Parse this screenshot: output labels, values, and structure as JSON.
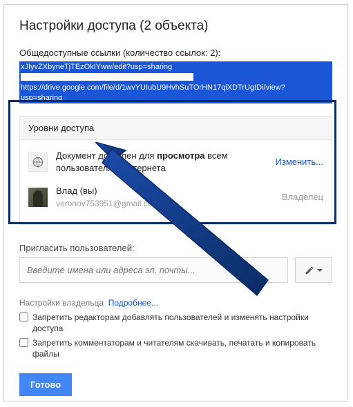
{
  "title": "Настройки доступа (2 объекта)",
  "links": {
    "label": "Общедоступные ссылки (количество ссылок: 2):",
    "line1": "xJIyvZXbyneTjTEzOkIYww/edit?usp=sharing",
    "line2": "https://drive.google.com/file/d/1wvYUIubU9HvhSuTOrHN17qlXDTrUgIDi/view?",
    "line3": "usp=sharing"
  },
  "access": {
    "header": "Уровни доступа",
    "rows": [
      {
        "text_prefix": "Документ доступен для ",
        "text_bold": "просмотра",
        "text_suffix": " всем пользователям Интернета",
        "action": "Изменить..."
      },
      {
        "name": "Влад (вы)",
        "email": "voronov753951@gmail.com",
        "role": "Владелец"
      }
    ]
  },
  "invite": {
    "label": "Пригласить пользователей:",
    "placeholder": "Введите имена или адреса эл. почты..."
  },
  "owner": {
    "label": "Настройки владельца",
    "more": "Подробнее...",
    "cb1": "Запретить редакторам добавлять пользователей и изменять настройки доступа",
    "cb2": "Запретить комментаторам и читателям скачивать, печатать и копировать файлы"
  },
  "done": "Готово"
}
